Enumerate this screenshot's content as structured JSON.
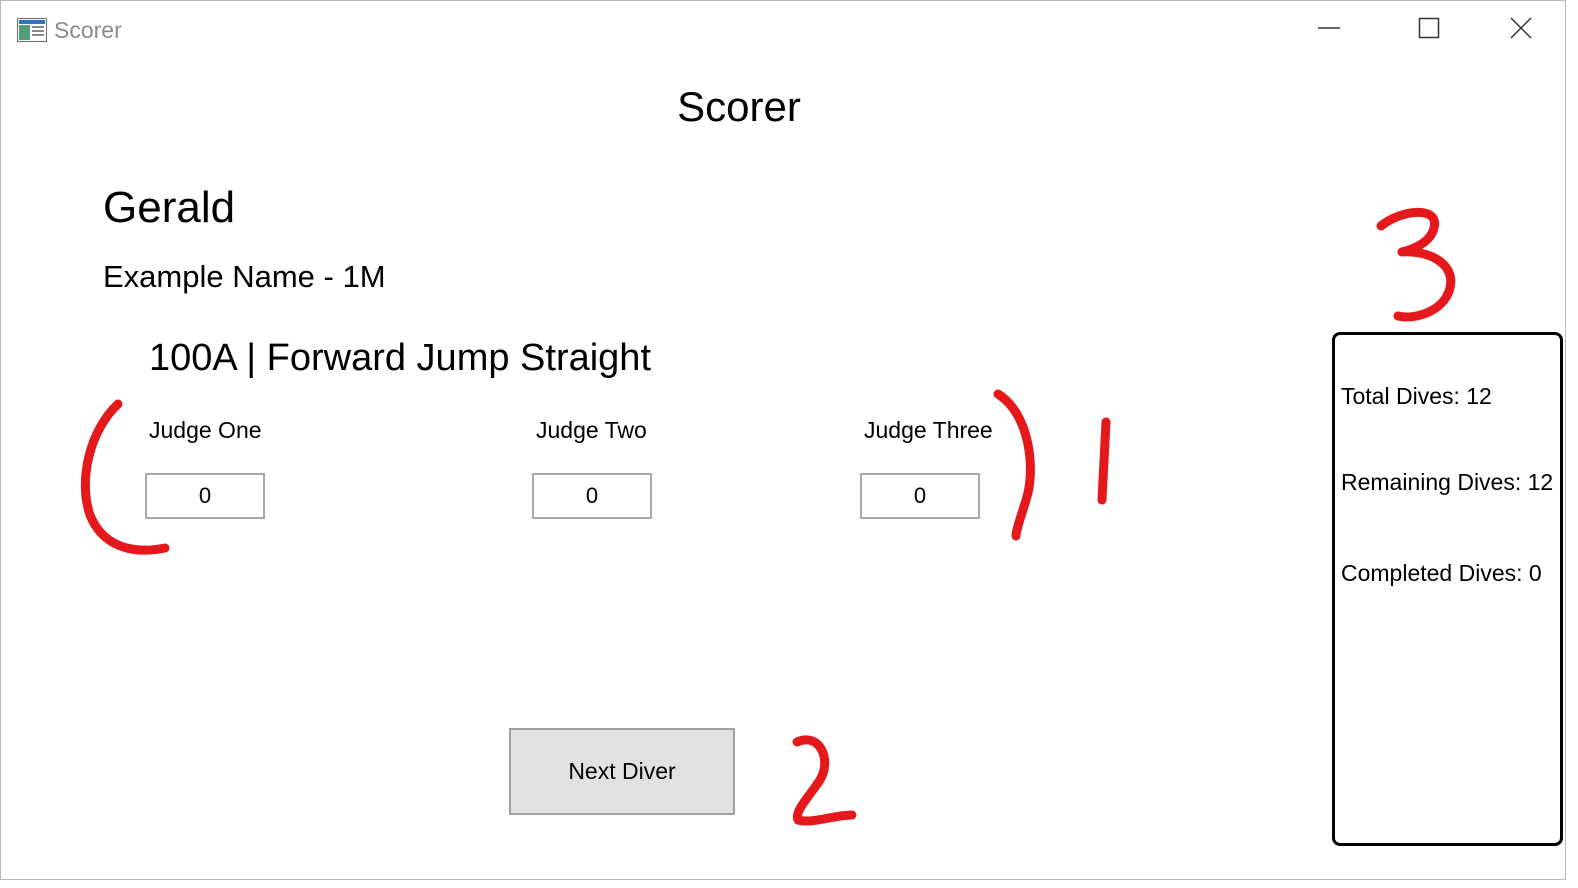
{
  "window": {
    "title": "Scorer",
    "icon": "app-window-icon",
    "controls": [
      "minimize-icon",
      "maximize-icon",
      "close-icon"
    ]
  },
  "heading": "Scorer",
  "diver": {
    "name": "Gerald",
    "event": "Example Name - 1M",
    "dive": "100A | Forward Jump Straight"
  },
  "judges": [
    {
      "label": "Judge One",
      "value": "0"
    },
    {
      "label": "Judge Two",
      "value": "0"
    },
    {
      "label": "Judge Three",
      "value": "0"
    }
  ],
  "actions": {
    "next_label": "Next Diver"
  },
  "stats": {
    "total": "Total Dives: 12",
    "remaining": "Remaining Dives: 12",
    "completed": "Completed Dives: 0"
  },
  "annotations": {
    "color": "#e3191c",
    "numbers": [
      "1",
      "2",
      "3"
    ]
  }
}
